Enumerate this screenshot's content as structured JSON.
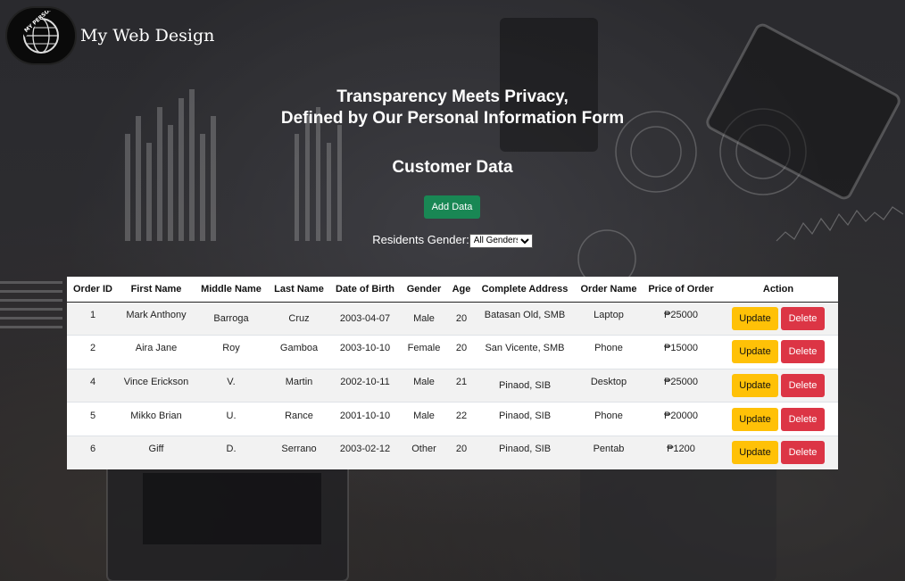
{
  "brand": {
    "logo_text": "MY PERSONAL WEB",
    "name": "My Web Design"
  },
  "hero": {
    "line1": "Transparency Meets Privacy,",
    "line2": "Defined by Our Personal Information Form"
  },
  "section_title": "Customer Data",
  "add_button_label": "Add Data",
  "filter": {
    "label": "Residents Gender:",
    "selected": "All Genders"
  },
  "table": {
    "headers": [
      "Order ID",
      "First Name",
      "Middle Name",
      "Last Name",
      "Date of Birth",
      "Gender",
      "Age",
      "Complete Address",
      "Order Name",
      "Price of Order",
      "Action"
    ],
    "rows": [
      [
        "1",
        "Mark Anthony",
        "Barroga",
        "Cruz",
        "2003-04-07",
        "Male",
        "20",
        "Batasan Old, SMB",
        "Laptop",
        "₱25000"
      ],
      [
        "2",
        "Aira Jane",
        "Roy",
        "Gamboa",
        "2003-10-10",
        "Female",
        "20",
        "San Vicente, SMB",
        "Phone",
        "₱15000"
      ],
      [
        "4",
        "Vince Erickson",
        "V.",
        "Martin",
        "2002-10-11",
        "Male",
        "21",
        "Pinaod, SIB",
        "Desktop",
        "₱25000"
      ],
      [
        "5",
        "Mikko Brian",
        "U.",
        "Rance",
        "2001-10-10",
        "Male",
        "22",
        "Pinaod, SIB",
        "Phone",
        "₱20000"
      ],
      [
        "6",
        "Giff",
        "D.",
        "Serrano",
        "2003-02-12",
        "Other",
        "20",
        "Pinaod, SIB",
        "Pentab",
        "₱1200"
      ]
    ],
    "update_label": "Update",
    "delete_label": "Delete"
  },
  "colors": {
    "add_button": "#198754",
    "update_button": "#ffc107",
    "delete_button": "#dc3545"
  }
}
